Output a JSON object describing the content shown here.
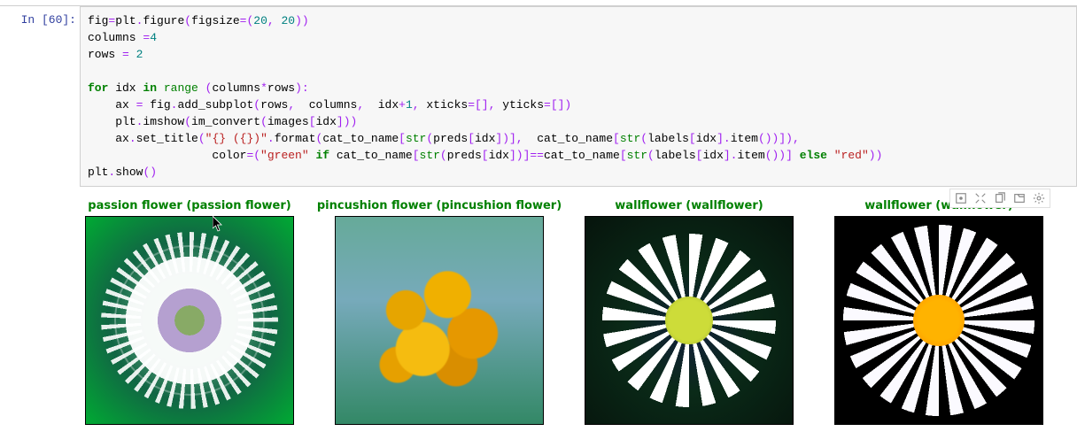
{
  "cell": {
    "prompt": "In [60]:",
    "code_tokens": [
      [
        [
          "",
          "fig"
        ],
        [
          "op",
          "="
        ],
        [
          "",
          "plt"
        ],
        [
          "op",
          "."
        ],
        [
          "",
          "figure"
        ],
        [
          "op",
          "("
        ],
        [
          "",
          "figsize"
        ],
        [
          "op",
          "=("
        ],
        [
          "num",
          "20"
        ],
        [
          "op",
          ", "
        ],
        [
          "num",
          "20"
        ],
        [
          "op",
          "))"
        ]
      ],
      [
        [
          "",
          "columns "
        ],
        [
          "op",
          "="
        ],
        [
          "num",
          "4"
        ]
      ],
      [
        [
          "",
          "rows "
        ],
        [
          "op",
          "= "
        ],
        [
          "num",
          "2"
        ]
      ],
      [],
      [
        [
          "k",
          "for"
        ],
        [
          "",
          " idx "
        ],
        [
          "k",
          "in"
        ],
        [
          "",
          " "
        ],
        [
          "b",
          "range"
        ],
        [
          "",
          " "
        ],
        [
          "op",
          "("
        ],
        [
          "",
          "columns"
        ],
        [
          "op",
          "*"
        ],
        [
          "",
          "rows"
        ],
        [
          "op",
          "):"
        ]
      ],
      [
        [
          "",
          "    ax "
        ],
        [
          "op",
          "="
        ],
        [
          "",
          " fig"
        ],
        [
          "op",
          "."
        ],
        [
          "",
          "add_subplot"
        ],
        [
          "op",
          "("
        ],
        [
          "",
          "rows"
        ],
        [
          "op",
          ",  "
        ],
        [
          "",
          "columns"
        ],
        [
          "op",
          ",  "
        ],
        [
          "",
          "idx"
        ],
        [
          "op",
          "+"
        ],
        [
          "num",
          "1"
        ],
        [
          "op",
          ", "
        ],
        [
          "",
          "xticks"
        ],
        [
          "op",
          "=[], "
        ],
        [
          "",
          "yticks"
        ],
        [
          "op",
          "=[])"
        ]
      ],
      [
        [
          "",
          "    plt"
        ],
        [
          "op",
          "."
        ],
        [
          "",
          "imshow"
        ],
        [
          "op",
          "("
        ],
        [
          "",
          "im_convert"
        ],
        [
          "op",
          "("
        ],
        [
          "",
          "images"
        ],
        [
          "op",
          "["
        ],
        [
          "",
          "idx"
        ],
        [
          "op",
          "]))"
        ]
      ],
      [
        [
          "",
          "    ax"
        ],
        [
          "op",
          "."
        ],
        [
          "",
          "set_title"
        ],
        [
          "op",
          "("
        ],
        [
          "s",
          "\"{} ({})\""
        ],
        [
          "op",
          "."
        ],
        [
          "",
          "format"
        ],
        [
          "op",
          "("
        ],
        [
          "",
          "cat_to_name"
        ],
        [
          "op",
          "["
        ],
        [
          "b",
          "str"
        ],
        [
          "op",
          "("
        ],
        [
          "",
          "preds"
        ],
        [
          "op",
          "["
        ],
        [
          "",
          "idx"
        ],
        [
          "op",
          "])],  "
        ],
        [
          "",
          "cat_to_name"
        ],
        [
          "op",
          "["
        ],
        [
          "b",
          "str"
        ],
        [
          "op",
          "("
        ],
        [
          "",
          "labels"
        ],
        [
          "op",
          "["
        ],
        [
          "",
          "idx"
        ],
        [
          "op",
          "]."
        ],
        [
          "",
          "item"
        ],
        [
          "op",
          "())]),"
        ]
      ],
      [
        [
          "",
          "                  color"
        ],
        [
          "op",
          "=("
        ],
        [
          "s",
          "\"green\""
        ],
        [
          "",
          " "
        ],
        [
          "k",
          "if"
        ],
        [
          "",
          " cat_to_name"
        ],
        [
          "op",
          "["
        ],
        [
          "b",
          "str"
        ],
        [
          "op",
          "("
        ],
        [
          "",
          "preds"
        ],
        [
          "op",
          "["
        ],
        [
          "",
          "idx"
        ],
        [
          "op",
          "])]"
        ],
        [
          "op",
          "=="
        ],
        [
          "",
          "cat_to_name"
        ],
        [
          "op",
          "["
        ],
        [
          "b",
          "str"
        ],
        [
          "op",
          "("
        ],
        [
          "",
          "labels"
        ],
        [
          "op",
          "["
        ],
        [
          "",
          "idx"
        ],
        [
          "op",
          "]."
        ],
        [
          "",
          "item"
        ],
        [
          "op",
          "())] "
        ],
        [
          "k",
          "else"
        ],
        [
          "",
          " "
        ],
        [
          "s",
          "\"red\""
        ],
        [
          "op",
          "))"
        ]
      ],
      [
        [
          "",
          "plt"
        ],
        [
          "op",
          "."
        ],
        [
          "",
          "show"
        ],
        [
          "op",
          "()"
        ]
      ]
    ]
  },
  "toolbar": {
    "icons": [
      "home-icon",
      "expand-icon",
      "copy-icon",
      "open-icon",
      "gear-icon"
    ]
  },
  "output": {
    "subplots": [
      {
        "title": "passion flower (passion flower)",
        "title_color": "green",
        "flower_class": "pf"
      },
      {
        "title": "pincushion flower (pincushion flower)",
        "title_color": "green",
        "flower_class": "pc"
      },
      {
        "title": "wallflower (wallflower)",
        "title_color": "green",
        "flower_class": "wf1"
      },
      {
        "title": "wallflower (wallflower)",
        "title_color": "green",
        "flower_class": "wf2"
      }
    ]
  }
}
